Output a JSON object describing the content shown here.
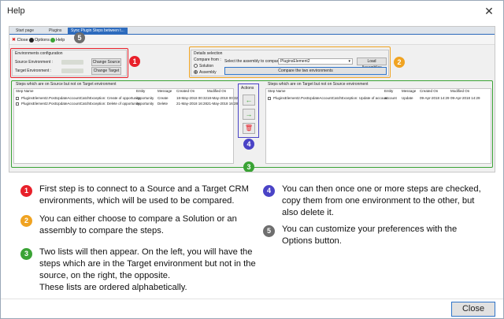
{
  "window": {
    "title": "Help",
    "close_glyph": "✕"
  },
  "screenshot": {
    "tabs": [
      {
        "label": "Start page"
      },
      {
        "label": "Plugins"
      },
      {
        "label": "Sync Plugin Steps between t..."
      }
    ],
    "toolbar": {
      "close_label": "Close",
      "options_label": "Options",
      "help_label": "Help"
    },
    "env_config": {
      "title": "Environments configuration",
      "source_label": "Source Environment :",
      "target_label": "Target Environment :",
      "change_source": "Change Source",
      "change_target": "Change Target"
    },
    "details": {
      "title": "Details selection",
      "compare_from": "Compare from :",
      "solution_label": "Solution",
      "assembly_label": "Assembly",
      "select_assembly_label": "Select the assembly to compare :",
      "assembly_value": "PluginsElement2",
      "load_assemblies": "Load Assemblies",
      "compare_button": "Compare the two environments"
    },
    "left_list": {
      "title": "Steps which are on Source but not on Target environment",
      "columns": [
        "Step Name",
        "Entity",
        "Message",
        "Created On",
        "Modified On"
      ],
      "rows": [
        [
          "PluginsElement2.PostUpdateAccountCatchException: Create of opportunity",
          "opportunity",
          "Create",
          "18-May-2018 00:32",
          "18-May-2018 00:32"
        ],
        [
          "PluginsElement2.PostUpdateAccountCatchException: Delete of opportunity",
          "opportunity",
          "Delete",
          "21-May-2018 16:28",
          "21-May-2018 16:28"
        ]
      ]
    },
    "actions": {
      "title": "Actions",
      "copy_left": "←",
      "copy_right": "→",
      "delete": "🗑"
    },
    "right_list": {
      "title": "Steps which are on Target but not on Source environment",
      "columns": [
        "Step Name",
        "Entity",
        "Message",
        "Created On",
        "Modified On"
      ],
      "rows": [
        [
          "PluginsElement2.PostUpdateAccountCatchException: Update of account",
          "account",
          "Update",
          "09-Apr-2018 14:29",
          "09-Apr-2018 14:29"
        ]
      ]
    },
    "badges": [
      "1",
      "2",
      "3",
      "4",
      "5"
    ]
  },
  "colors": {
    "red": "#e8202a",
    "orange": "#f0a321",
    "green": "#3aa335",
    "purple": "#4a43c6",
    "grey": "#6e6e6e"
  },
  "legend": [
    {
      "num": "1",
      "lines": [
        "First step is to connect to a Source and a Target CRM",
        "environments, which will be used to be compared."
      ]
    },
    {
      "num": "2",
      "lines": [
        "You can either choose to compare a Solution or an",
        "assembly to compare the steps."
      ]
    },
    {
      "num": "3",
      "lines": [
        "Two lists will then appear. On the left, you will have the",
        "steps which are in the Target environment but not in the",
        "source, on the right, the opposite.",
        "These lists are ordered alphabetically."
      ]
    },
    {
      "num": "4",
      "lines": [
        "You can then once one or more steps are checked,",
        "copy them from one environment to the other, but",
        "also delete it."
      ]
    },
    {
      "num": "5",
      "lines": [
        "You can customize your preferences with the",
        "Options button."
      ]
    }
  ],
  "footer": {
    "close_label": "Close"
  }
}
